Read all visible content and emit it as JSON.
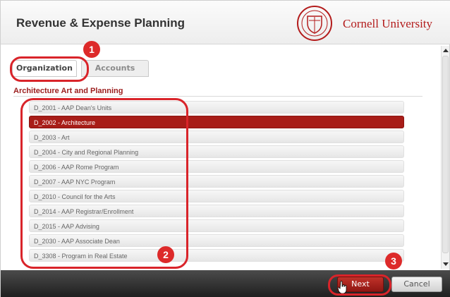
{
  "header": {
    "title": "Revenue & Expense Planning",
    "brand": "Cornell University",
    "logo_icon": "cornell-seal-icon"
  },
  "tabs": [
    {
      "label": "Organization",
      "active": true
    },
    {
      "label": "Accounts",
      "active": false
    }
  ],
  "section_title": "Architecture Art and Planning",
  "list_items": [
    {
      "label": "D_2001 - AAP Dean's Units",
      "selected": false
    },
    {
      "label": "D_2002 - Architecture",
      "selected": true
    },
    {
      "label": "D_2003 - Art",
      "selected": false
    },
    {
      "label": "D_2004 - City and Regional Planning",
      "selected": false
    },
    {
      "label": "D_2006 - AAP Rome Program",
      "selected": false
    },
    {
      "label": "D_2007 - AAP NYC Program",
      "selected": false
    },
    {
      "label": "D_2010 - Council for the Arts",
      "selected": false
    },
    {
      "label": "D_2014 - AAP Registrar/Enrollment",
      "selected": false
    },
    {
      "label": "D_2015 - AAP Advising",
      "selected": false
    },
    {
      "label": "D_2030 - AAP Associate Dean",
      "selected": false
    },
    {
      "label": "D_3308 - Program in Real Estate",
      "selected": false
    }
  ],
  "footer": {
    "next_label": "Next",
    "cancel_label": "Cancel"
  },
  "annotations": [
    "1",
    "2",
    "3"
  ],
  "colors": {
    "accent": "#a81d18",
    "annotation": "#d9242a",
    "brand": "#b31b1b"
  }
}
